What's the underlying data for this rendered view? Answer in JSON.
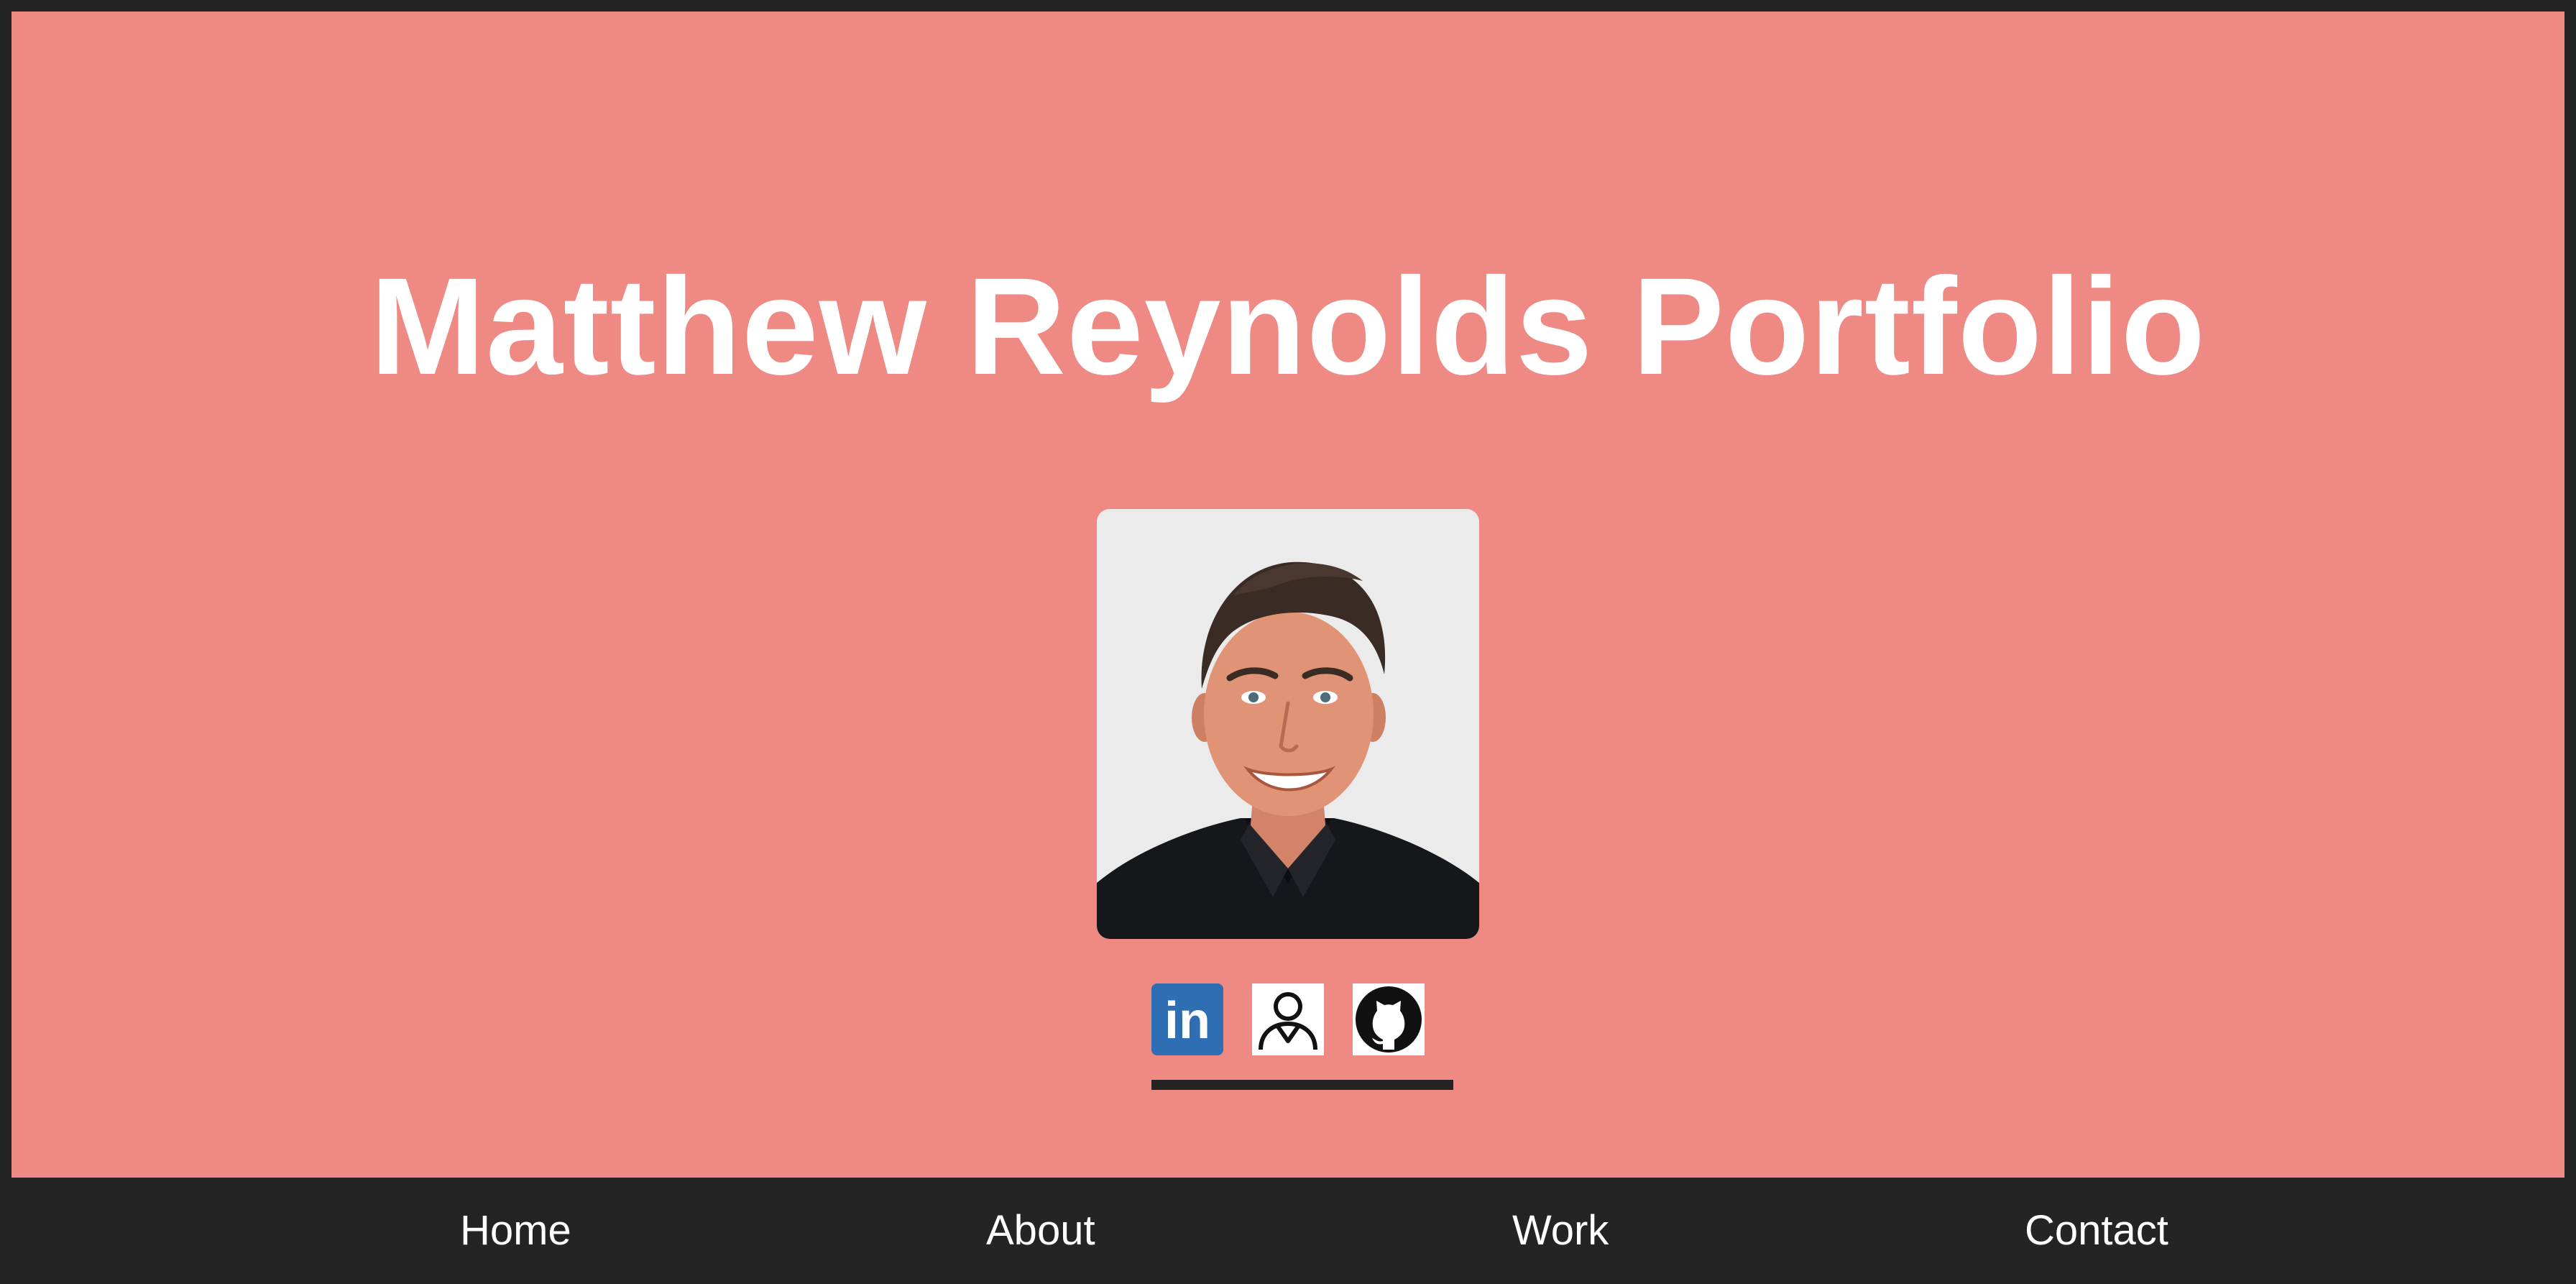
{
  "hero": {
    "title": "Matthew Reynolds Portfolio",
    "background_color": "#ee8984"
  },
  "portrait": {
    "alt": "Portrait photo of Matthew Reynolds"
  },
  "social": {
    "items": [
      {
        "name": "linkedin",
        "icon": "linkedin-icon",
        "label": "in",
        "color": "#2e6fb4"
      },
      {
        "name": "resume",
        "icon": "person-icon"
      },
      {
        "name": "github",
        "icon": "github-icon"
      }
    ]
  },
  "nav": {
    "background_color": "#242424",
    "items": [
      {
        "label": "Home"
      },
      {
        "label": "About"
      },
      {
        "label": "Work"
      },
      {
        "label": "Contact"
      }
    ]
  }
}
